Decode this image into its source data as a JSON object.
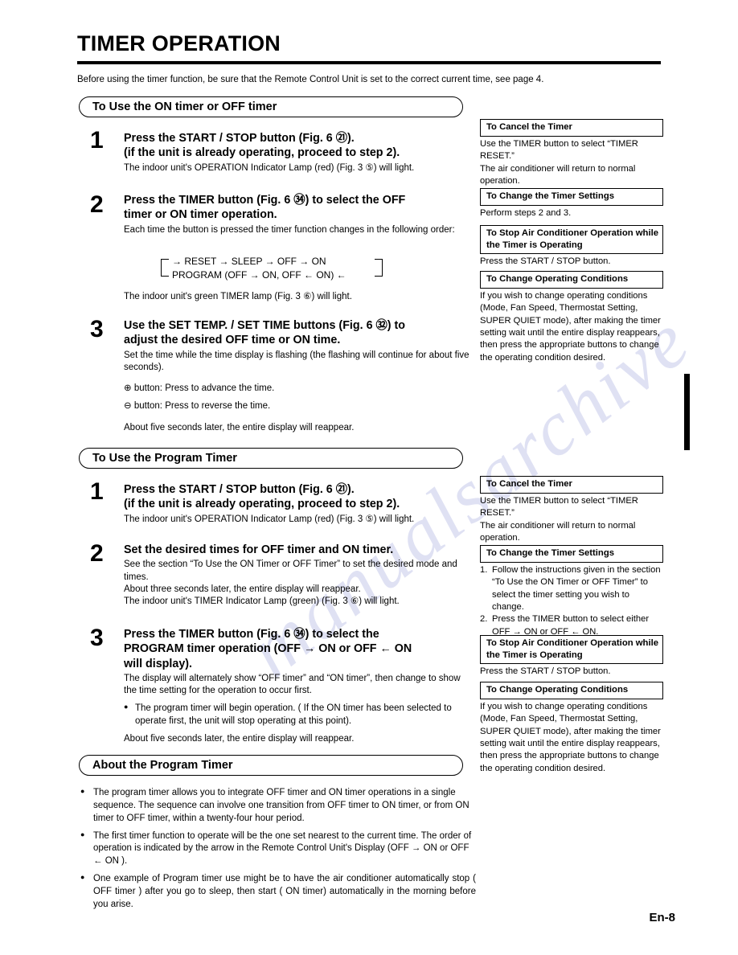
{
  "document": {
    "title": "TIMER OPERATION",
    "intro": "Before using the timer function, be sure that the Remote Control Unit is set to the correct current time, see page 4.",
    "page_number": "En-8"
  },
  "section_on_off": {
    "heading": "To Use the ON timer or OFF timer",
    "steps": [
      {
        "number": "1",
        "lead_line1": "Press the START / STOP button (Fig. 6 ㉑).",
        "lead_line2": "(if the unit is already operating, proceed to step 2).",
        "detail": "The indoor unit's OPERATION Indicator Lamp (red) (Fig. 3 ⑤) will light."
      },
      {
        "number": "2",
        "lead_line1": "Press the TIMER button (Fig. 6 ㉞) to select the OFF",
        "lead_line2": "timer or ON timer operation.",
        "detail": "Each time the button is pressed the timer function changes in the following order:",
        "cycle_top": "→ RESET → SLEEP → OFF → ON",
        "cycle_bottom": "PROGRAM (OFF → ON, OFF ← ON) ←",
        "detail_after": "The indoor unit's green TIMER lamp (Fig. 3 ⑥) will light."
      },
      {
        "number": "3",
        "lead_line1": "Use the SET TEMP. / SET TIME buttons (Fig. 6 ㉜) to",
        "lead_line2": "adjust the desired OFF time or ON time.",
        "detail": "Set the time while the time display is flashing (the flashing will continue for about five seconds).",
        "plus_line": "⊕ button: Press to advance the time.",
        "minus_line": "⊖ button: Press to reverse the time.",
        "detail_after": "About five seconds later, the entire display will reappear."
      }
    ]
  },
  "section_program": {
    "heading": "To Use the Program Timer",
    "steps": [
      {
        "number": "1",
        "lead_line1": "Press the START / STOP button (Fig. 6 ㉑).",
        "lead_line2": "(if the unit is already operating, proceed to step 2).",
        "detail": "The indoor unit's OPERATION Indicator Lamp (red) (Fig. 3 ⑤) will light."
      },
      {
        "number": "2",
        "lead_line1": "Set the desired times for OFF timer and ON timer.",
        "detail_l1": "See the section “To Use the ON Timer or OFF Timer” to set the desired mode and times.",
        "detail_l2": "About three seconds later, the entire display will reappear.",
        "detail_l3": "The indoor unit's TIMER Indicator Lamp (green) (Fig. 3 ⑥) will light."
      },
      {
        "number": "3",
        "lead_line1": "Press the TIMER button (Fig. 6 ㉞) to select the",
        "lead_line2": "PROGRAM timer operation (OFF → ON or OFF ← ON",
        "lead_line3": "will display).",
        "detail_l1": "The display will alternately show “OFF timer” and “ON timer”, then change to show the time setting for the operation to occur first.",
        "bullet": "The program timer will begin operation. ( If the ON timer has been selected to operate first, the unit will stop operating at this point).",
        "detail_l2": "About five seconds later, the entire display will reappear."
      }
    ]
  },
  "section_about": {
    "heading": "About the Program Timer",
    "bullets": [
      "The program timer allows you to integrate OFF timer and ON timer operations in a single sequence. The sequence can involve one transition from OFF timer to ON timer, or from ON timer to OFF timer, within a twenty-four hour period.",
      "The first timer function to operate will be the one set nearest to the current time. The order of operation is indicated by the arrow in the Remote Control Unit's Display (OFF → ON or OFF ← ON ).",
      "One example of Program timer use might be to have the air conditioner automatically stop ( OFF timer ) after you go to sleep, then start ( ON timer) automatically in the morning before you arise."
    ]
  },
  "sidebar_top": [
    {
      "heading": "To Cancel the Timer",
      "lines": [
        "Use the TIMER button to select “TIMER RESET.”",
        "The air conditioner will return to normal operation."
      ]
    },
    {
      "heading": "To Change the Timer Settings",
      "lines": [
        "Perform steps 2 and 3."
      ]
    },
    {
      "heading": "To Stop Air Conditioner Operation while the Timer is Operating",
      "lines": [
        "Press the START / STOP button."
      ]
    },
    {
      "heading": "To Change Operating Conditions",
      "lines": [
        "If you wish to change operating conditions (Mode, Fan Speed, Thermostat Setting, SUPER QUIET mode), after making the timer setting wait until the entire display reappears, then press the appropriate buttons to change the operating condition desired."
      ]
    }
  ],
  "sidebar_bottom": [
    {
      "heading": "To Cancel the Timer",
      "lines": [
        "Use the TIMER button to select “TIMER RESET.”",
        "The air conditioner will return to normal operation."
      ]
    },
    {
      "heading": "To Change the Timer Settings",
      "numbered": [
        "Follow the instructions given in the section “To Use the ON Timer or OFF Timer” to select the timer setting you wish to change.",
        "Press the TIMER button to select either OFF → ON or OFF ← ON."
      ]
    },
    {
      "heading": "To Stop Air Conditioner Operation while the Timer is Operating",
      "lines": [
        "Press the START / STOP button."
      ]
    },
    {
      "heading": "To Change Operating Conditions",
      "lines": [
        "If you wish to change operating conditions (Mode, Fan Speed, Thermostat Setting, SUPER QUIET mode), after making the timer setting wait until the entire display reappears, then press the appropriate buttons to change the operating condition desired."
      ]
    }
  ],
  "watermark": {
    "text": "manualsarchive",
    "color": "#969bd7"
  }
}
